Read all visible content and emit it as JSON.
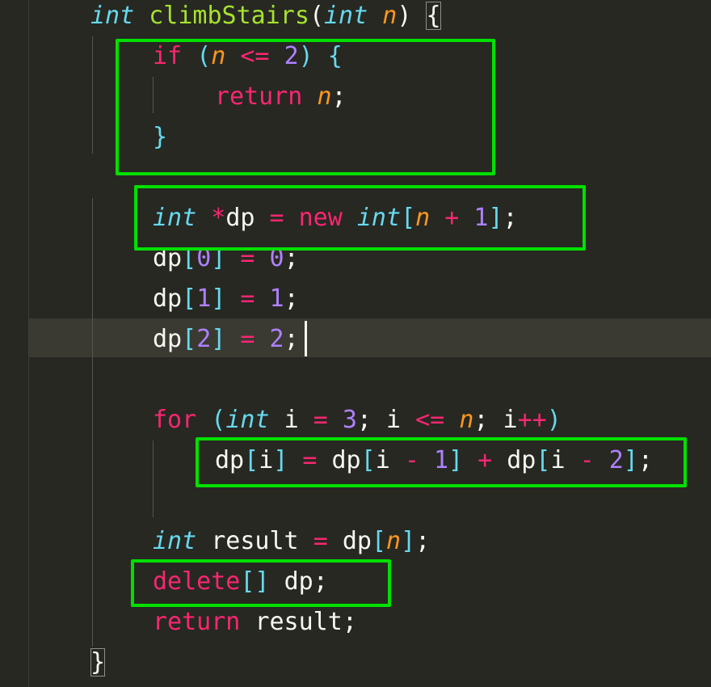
{
  "code": {
    "line1": {
      "type_int": "int",
      "function_name": "climbStairs",
      "paren_open": "(",
      "param_type": "int",
      "param_name": "n",
      "paren_close": ")",
      "brace_open": "{"
    },
    "line2": {
      "kw_if": "if",
      "paren_open": "(",
      "var_n": "n",
      "op_le": "<=",
      "num_2": "2",
      "paren_close": ")",
      "brace_open": "{"
    },
    "line3": {
      "kw_return": "return",
      "var_n": "n",
      "semicolon": ";"
    },
    "line4": {
      "brace_close": "}"
    },
    "line5": {
      "type_int": "int",
      "op_star": "*",
      "var_dp": "dp",
      "op_eq": "=",
      "kw_new": "new",
      "type_int2": "int",
      "bracket_open": "[",
      "var_n": "n",
      "op_plus": "+",
      "num_1": "1",
      "bracket_close": "]",
      "semicolon": ";"
    },
    "line6": {
      "var_dp": "dp",
      "bracket_open": "[",
      "num_0": "0",
      "bracket_close": "]",
      "op_eq": "=",
      "num_0b": "0",
      "semicolon": ";"
    },
    "line7": {
      "var_dp": "dp",
      "bracket_open": "[",
      "num_1": "1",
      "bracket_close": "]",
      "op_eq": "=",
      "num_1b": "1",
      "semicolon": ";"
    },
    "line8": {
      "var_dp": "dp",
      "bracket_open": "[",
      "num_2": "2",
      "bracket_close": "]",
      "op_eq": "=",
      "num_2b": "2",
      "semicolon": ";"
    },
    "line10": {
      "kw_for": "for",
      "paren_open": "(",
      "type_int": "int",
      "var_i": "i",
      "op_eq": "=",
      "num_3": "3",
      "semi1": ";",
      "var_i2": "i",
      "op_le": "<=",
      "var_n": "n",
      "semi2": ";",
      "var_i3": "i",
      "op_inc": "++",
      "paren_close": ")"
    },
    "line11": {
      "var_dp": "dp",
      "b1_open": "[",
      "var_i": "i",
      "b1_close": "]",
      "op_eq": "=",
      "var_dp2": "dp",
      "b2_open": "[",
      "var_i2": "i",
      "op_minus": "-",
      "num_1": "1",
      "b2_close": "]",
      "op_plus": "+",
      "var_dp3": "dp",
      "b3_open": "[",
      "var_i3": "i",
      "op_minus2": "-",
      "num_2": "2",
      "b3_close": "]",
      "semicolon": ";"
    },
    "line13": {
      "type_int": "int",
      "var_result": "result",
      "op_eq": "=",
      "var_dp": "dp",
      "bracket_open": "[",
      "var_n": "n",
      "bracket_close": "]",
      "semicolon": ";"
    },
    "line14": {
      "kw_delete": "delete",
      "brackets": "[]",
      "var_dp": "dp",
      "semicolon": ";"
    },
    "line15": {
      "kw_return": "return",
      "var_result": "result",
      "semicolon": ";"
    },
    "line16": {
      "brace_close": "}"
    }
  },
  "colors": {
    "background": "#272822",
    "keyword": "#f92672",
    "type": "#66d9ef",
    "function": "#a6e22e",
    "parameter": "#fd971f",
    "number": "#ae81ff",
    "plain": "#f8f8f2",
    "highlight_box": "#00e000"
  }
}
